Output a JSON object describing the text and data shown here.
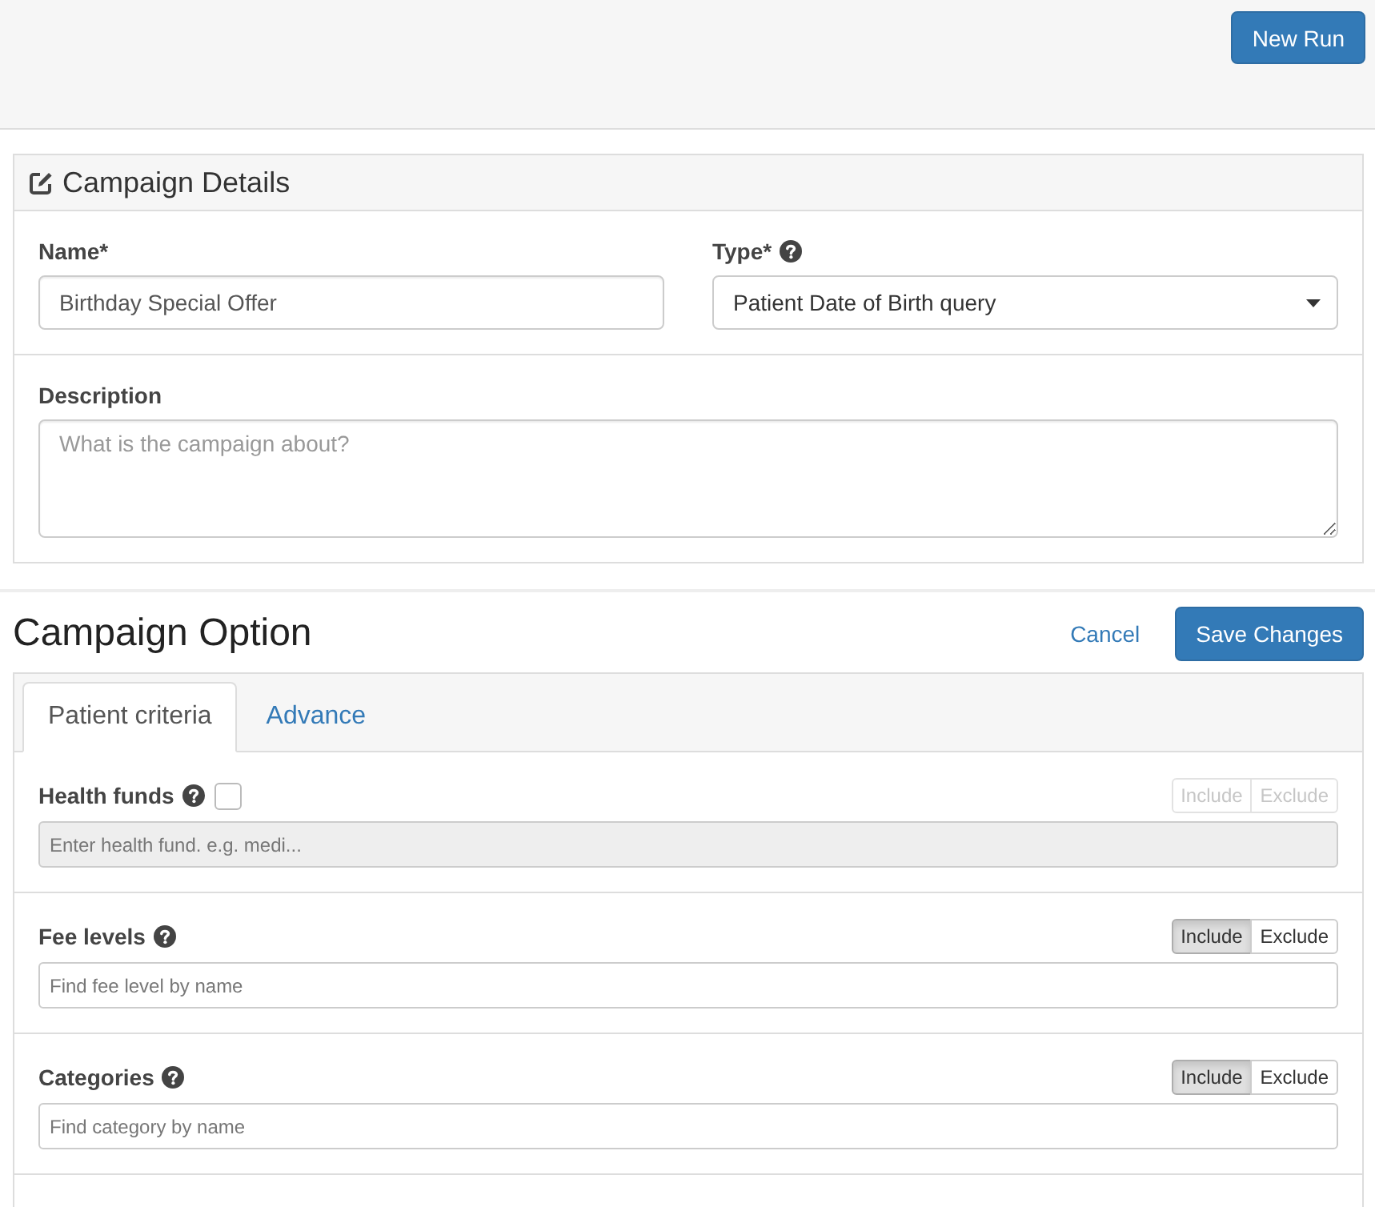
{
  "header": {
    "new_run_button": "New Run"
  },
  "campaign_details": {
    "title": "Campaign Details",
    "fields": [
      {
        "label": "Name*",
        "help": false,
        "kind": "text",
        "value": "Birthday Special Offer"
      },
      {
        "label": "Type*",
        "help": true,
        "kind": "select",
        "value": "Patient Date of Birth query"
      }
    ],
    "description": {
      "label": "Description",
      "placeholder": "What is the campaign about?"
    }
  },
  "campaign_option": {
    "title": "Campaign Option",
    "cancel_link": "Cancel",
    "save_button": "Save Changes",
    "tabs": [
      {
        "label": "Patient criteria",
        "selected": true
      },
      {
        "label": "Advance",
        "selected": false
      }
    ],
    "criteria": [
      {
        "label": "Health funds",
        "help": true,
        "checkbox": {
          "checked": false
        },
        "disabled": true,
        "placeholder": "Enter health fund. e.g. medi...",
        "toggle": [
          {
            "label": "Include",
            "selected": false
          },
          {
            "label": "Exclude",
            "selected": false
          }
        ]
      },
      {
        "label": "Fee levels",
        "help": true,
        "disabled": false,
        "placeholder": "Find fee level by name",
        "toggle": [
          {
            "label": "Include",
            "selected": true
          },
          {
            "label": "Exclude",
            "selected": false
          }
        ]
      },
      {
        "label": "Categories",
        "help": true,
        "disabled": false,
        "placeholder": "Find category by name",
        "toggle": [
          {
            "label": "Include",
            "selected": true
          },
          {
            "label": "Exclude",
            "selected": false
          }
        ]
      }
    ]
  }
}
